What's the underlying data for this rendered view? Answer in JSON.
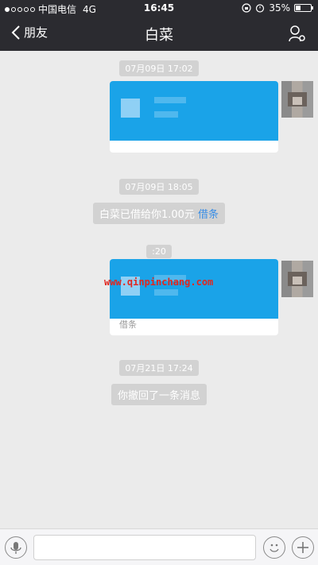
{
  "status_bar": {
    "carrier": "中国电信",
    "network": "4G",
    "time": "16:45",
    "battery": "35%",
    "battery_level": 0.35
  },
  "navbar": {
    "back_label": "朋友",
    "title": "白菜",
    "icons": {
      "back": "chevron-left-icon",
      "profile": "person-settings-icon"
    }
  },
  "messages": [
    {
      "type": "timestamp",
      "text": "07月09日 17:02"
    },
    {
      "type": "card",
      "side": "right",
      "footer": ""
    },
    {
      "type": "timestamp",
      "text": "07月09日 18:05"
    },
    {
      "type": "system",
      "text": "白菜已借给你1.00元",
      "link": "借条"
    },
    {
      "type": "timestamp",
      "text": ":20"
    },
    {
      "type": "card",
      "side": "right",
      "footer": "借条"
    },
    {
      "type": "timestamp",
      "text": "07月21日 17:24"
    },
    {
      "type": "system",
      "text": "你撤回了一条消息"
    }
  ],
  "watermark": "www.qinpinchang.com",
  "input_bar": {
    "placeholder": "",
    "icons": {
      "voice": "microphone-icon",
      "emoji": "smiley-icon",
      "more": "plus-icon"
    }
  },
  "colors": {
    "bar": "#2b2b30",
    "background": "#ebebeb",
    "card_blue": "#1aa3e8",
    "link": "#3a8ee6"
  }
}
